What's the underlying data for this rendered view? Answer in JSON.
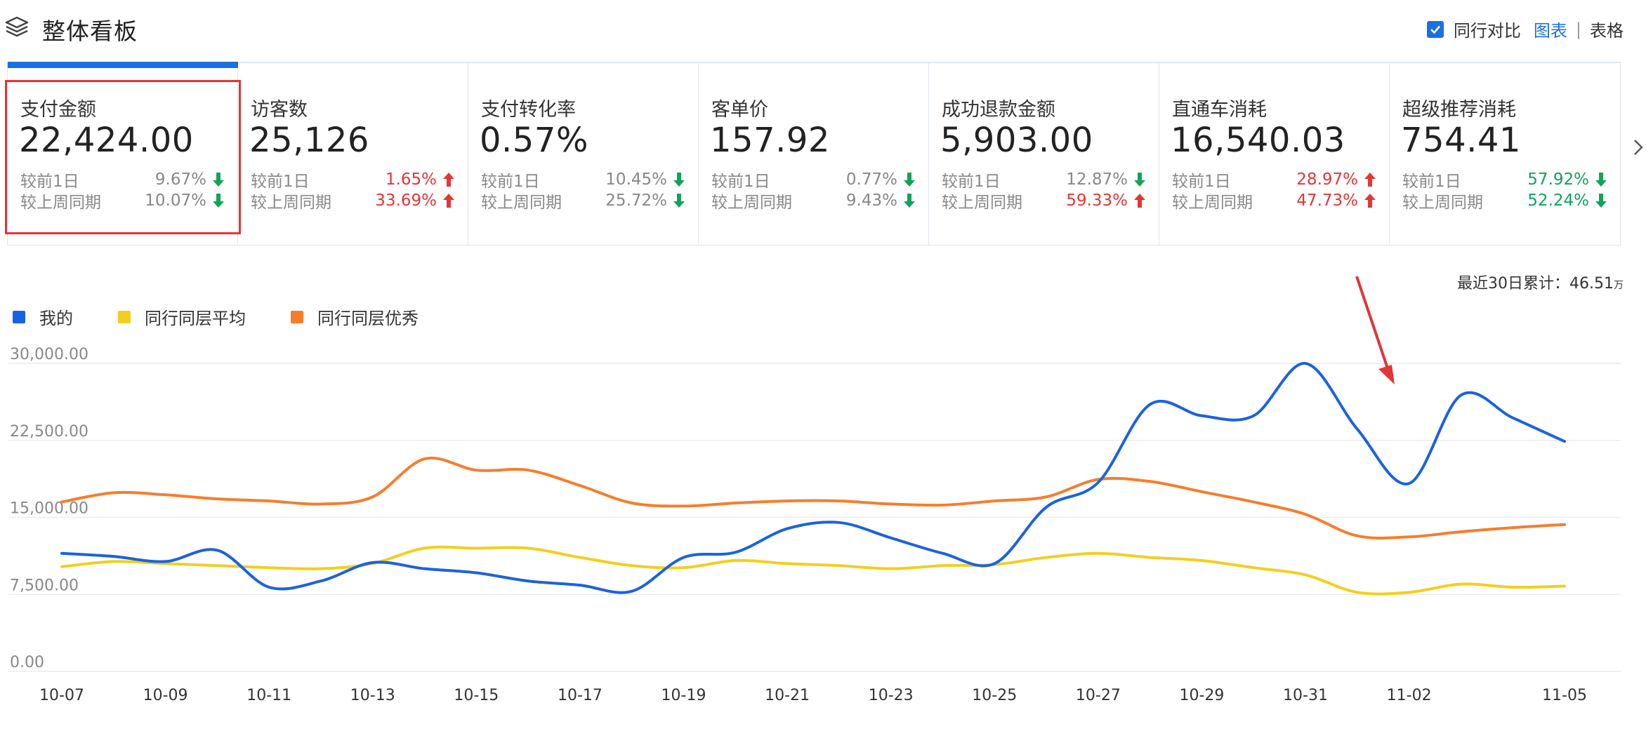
{
  "header": {
    "title": "整体看板",
    "compare_checkbox_label": "同行对比",
    "view_chart_label": "图表",
    "view_separator": "|",
    "view_table_label": "表格"
  },
  "colors": {
    "accent": "#1b6fe0",
    "up": "#e53535",
    "down": "#10a35b",
    "selected_border": "#e0353a"
  },
  "cards": [
    {
      "name": "支付金额",
      "value": "22,424.00",
      "c1_label": "较前1日",
      "c1_val": "9.67%",
      "c1_dir": "down",
      "c2_label": "较上周同期",
      "c2_val": "10.07%",
      "c2_dir": "down",
      "hl": false
    },
    {
      "name": "访客数",
      "value": "25,126",
      "c1_label": "较前1日",
      "c1_val": "1.65%",
      "c1_dir": "up",
      "c2_label": "较上周同期",
      "c2_val": "33.69%",
      "c2_dir": "up",
      "hl": false
    },
    {
      "name": "支付转化率",
      "value": "0.57%",
      "c1_label": "较前1日",
      "c1_val": "10.45%",
      "c1_dir": "down",
      "c2_label": "较上周同期",
      "c2_val": "25.72%",
      "c2_dir": "down",
      "hl": false
    },
    {
      "name": "客单价",
      "value": "157.92",
      "c1_label": "较前1日",
      "c1_val": "0.77%",
      "c1_dir": "down",
      "c2_label": "较上周同期",
      "c2_val": "9.43%",
      "c2_dir": "down",
      "hl": false
    },
    {
      "name": "成功退款金额",
      "value": "5,903.00",
      "c1_label": "较前1日",
      "c1_val": "12.87%",
      "c1_dir": "down",
      "c2_label": "较上周同期",
      "c2_val": "59.33%",
      "c2_dir": "up",
      "hl": false
    },
    {
      "name": "直通车消耗",
      "value": "16,540.03",
      "c1_label": "较前1日",
      "c1_val": "28.97%",
      "c1_dir": "up",
      "c2_label": "较上周同期",
      "c2_val": "47.73%",
      "c2_dir": "up",
      "hl": false
    },
    {
      "name": "超级推荐消耗",
      "value": "754.41",
      "c1_label": "较前1日",
      "c1_val": "57.92%",
      "c1_dir": "down",
      "c2_label": "较上周同期",
      "c2_val": "52.24%",
      "c2_dir": "down",
      "hl": true
    }
  ],
  "summary": {
    "label": "最近30日累计：",
    "value": "46.51",
    "unit": "万"
  },
  "chart_data": {
    "type": "line",
    "legend_position": "top-left",
    "grid": true,
    "ylim": [
      0,
      30000
    ],
    "y_ticks": [
      "0.00",
      "7,500.00",
      "15,000.00",
      "22,500.00",
      "30,000.00"
    ],
    "x_tick_labels": [
      "10-07",
      "10-09",
      "10-11",
      "10-13",
      "10-15",
      "10-17",
      "10-19",
      "10-21",
      "10-23",
      "10-25",
      "10-27",
      "10-29",
      "10-31",
      "11-02",
      "11-05"
    ],
    "x": [
      "10-07",
      "10-08",
      "10-09",
      "10-10",
      "10-11",
      "10-12",
      "10-13",
      "10-14",
      "10-15",
      "10-16",
      "10-17",
      "10-18",
      "10-19",
      "10-20",
      "10-21",
      "10-22",
      "10-23",
      "10-24",
      "10-25",
      "10-26",
      "10-27",
      "10-28",
      "10-29",
      "10-30",
      "10-31",
      "11-01",
      "11-02",
      "11-03",
      "11-04",
      "11-05"
    ],
    "series": [
      {
        "name": "我的",
        "color": "#1b62e0",
        "values": [
          11500,
          11200,
          10700,
          11800,
          8200,
          8800,
          10600,
          10000,
          9600,
          8800,
          8400,
          7800,
          11100,
          11600,
          13900,
          14500,
          13000,
          11500,
          10500,
          16000,
          18400,
          26000,
          24900,
          24900,
          30000,
          23600,
          18300,
          26900,
          24700,
          22400
        ]
      },
      {
        "name": "同行同层平均",
        "color": "#f2cf1d",
        "values": [
          10200,
          10700,
          10500,
          10300,
          10100,
          10000,
          10500,
          12000,
          12000,
          12000,
          11100,
          10300,
          10100,
          10800,
          10500,
          10300,
          10000,
          10300,
          10400,
          11100,
          11500,
          11100,
          10800,
          10100,
          9400,
          7700,
          7700,
          8500,
          8200,
          8300
        ]
      },
      {
        "name": "同行同层优秀",
        "color": "#f77d2b",
        "values": [
          16500,
          17400,
          17200,
          16800,
          16600,
          16300,
          17000,
          20700,
          19600,
          19600,
          18100,
          16400,
          16100,
          16400,
          16600,
          16600,
          16300,
          16200,
          16600,
          17000,
          18700,
          18500,
          17500,
          16500,
          15300,
          13200,
          13100,
          13600,
          14000,
          14300
        ]
      }
    ]
  }
}
